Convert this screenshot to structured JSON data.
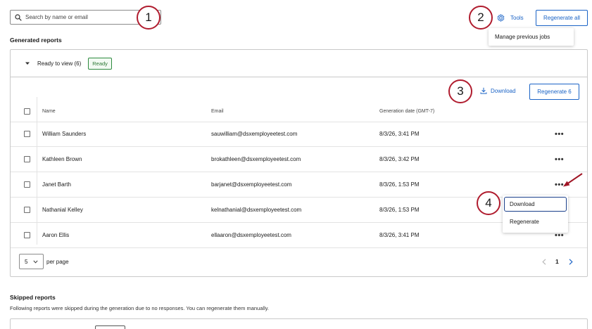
{
  "search": {
    "placeholder": "Search by name or email"
  },
  "callouts": [
    "1",
    "2",
    "3",
    "4"
  ],
  "toolbar": {
    "tools_label": "Tools",
    "regenerate_all_label": "Regenerate all"
  },
  "tools_menu": {
    "items": [
      "Manage previous jobs"
    ]
  },
  "generated": {
    "heading": "Generated reports",
    "group_label": "Ready to view (6)",
    "badge": "Ready",
    "download_label": "Download",
    "regenerate_label": "Regenerate 6",
    "columns": {
      "name": "Name",
      "email": "Email",
      "date": "Generation date (GMT-7)"
    },
    "rows": [
      {
        "name": "William Saunders",
        "email": "sauwilliam@dsxemployeetest.com",
        "date": "8/3/26, 3:41 PM"
      },
      {
        "name": "Kathleen Brown",
        "email": "brokathleen@dsxemployeetest.com",
        "date": "8/3/26, 3:42 PM"
      },
      {
        "name": "Janet Barth",
        "email": "barjanet@dsxemployeetest.com",
        "date": "8/3/26, 1:53 PM"
      },
      {
        "name": "Nathanial Kelley",
        "email": "kelnathanial@dsxemployeetest.com",
        "date": "8/3/26, 1:53 PM"
      },
      {
        "name": "Aaron Ellis",
        "email": "ellaaron@dsxemployeetest.com",
        "date": "8/3/26, 3:41 PM"
      }
    ],
    "more_glyph": "•••"
  },
  "row_menu": {
    "items": [
      "Download",
      "Regenerate"
    ]
  },
  "pagination": {
    "per_page_value": "5",
    "per_page_label": "per page",
    "current_page": "1"
  },
  "skipped": {
    "heading": "Skipped reports",
    "description": "Following reports were skipped during the generation due to no responses. You can regenerate them manually."
  },
  "colors": {
    "accent": "#1a63c6",
    "callout": "#b01c2e",
    "ready": "#2d8a3e"
  }
}
